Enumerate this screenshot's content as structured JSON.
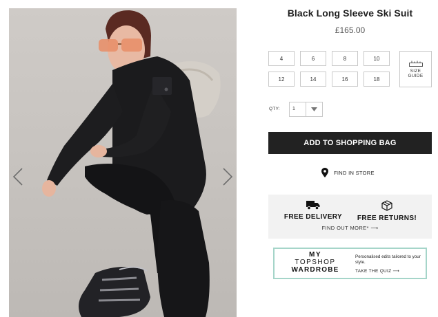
{
  "product": {
    "title": "Black Long Sleeve Ski Suit",
    "price": "£165.00"
  },
  "sizes": [
    "4",
    "6",
    "8",
    "10",
    "12",
    "14",
    "16",
    "18"
  ],
  "size_guide": {
    "line1": "SIZE",
    "line2": "GUIDE",
    "icon": "ruler-icon"
  },
  "quantity": {
    "label": "QTY:",
    "value": "1",
    "icon": "chevron-down-icon"
  },
  "add_button": {
    "label": "ADD TO SHOPPING BAG"
  },
  "find_store": {
    "label": "FIND IN STORE",
    "icon": "map-pin-icon"
  },
  "delivery": {
    "free_delivery": "FREE DELIVERY",
    "free_returns": "FREE RETURNS!",
    "find_out_more": "FIND OUT MORE* ⟶",
    "icons": [
      "truck-icon",
      "package-icon"
    ]
  },
  "wardrobe_promo": {
    "line1": "MY",
    "line2": "TOPSHOP",
    "line3": "WARDROBE",
    "copy": "Personalised edits tailored to your style.",
    "cta": "TAKE THE QUIZ ⟶"
  },
  "gallery": {
    "prev_icon": "chevron-left-icon",
    "next_icon": "chevron-right-icon"
  },
  "colors": {
    "button_dark": "#222222",
    "promo_border": "#a5d5c9",
    "panel_bg": "#f2f2f2"
  }
}
